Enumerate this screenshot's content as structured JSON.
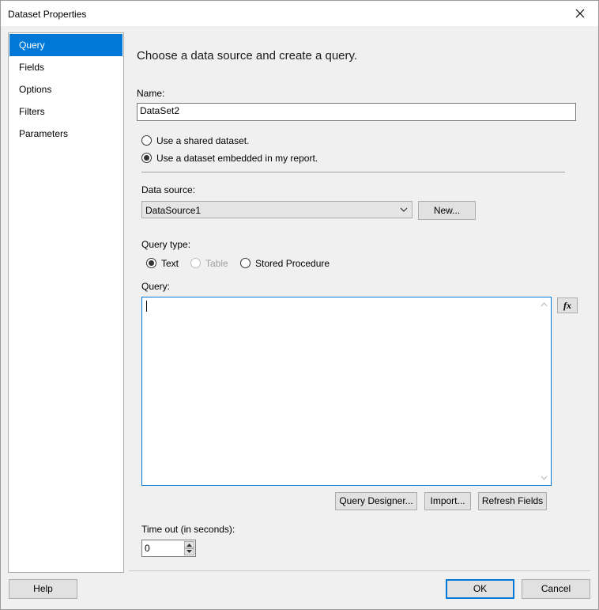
{
  "window": {
    "title": "Dataset Properties"
  },
  "sidebar": {
    "items": [
      {
        "label": "Query",
        "selected": true
      },
      {
        "label": "Fields"
      },
      {
        "label": "Options"
      },
      {
        "label": "Filters"
      },
      {
        "label": "Parameters"
      }
    ]
  },
  "main": {
    "heading": "Choose a data source and create a query.",
    "name_label": "Name:",
    "name_value": "DataSet2",
    "radio_shared": "Use a shared dataset.",
    "radio_embedded": "Use a dataset embedded in my report.",
    "datasource_label": "Data source:",
    "datasource_value": "DataSource1",
    "new_button": "New...",
    "querytype_label": "Query type:",
    "qt_text": "Text",
    "qt_table": "Table",
    "qt_stored": "Stored Procedure",
    "query_label": "Query:",
    "query_value": "",
    "fx_label": "fx",
    "query_designer_button": "Query Designer...",
    "import_button": "Import...",
    "refresh_button": "Refresh Fields",
    "timeout_label": "Time out (in seconds):",
    "timeout_value": "0"
  },
  "footer": {
    "help": "Help",
    "ok": "OK",
    "cancel": "Cancel"
  },
  "colors": {
    "accent": "#0078d7",
    "panel": "#f0f0f0"
  }
}
